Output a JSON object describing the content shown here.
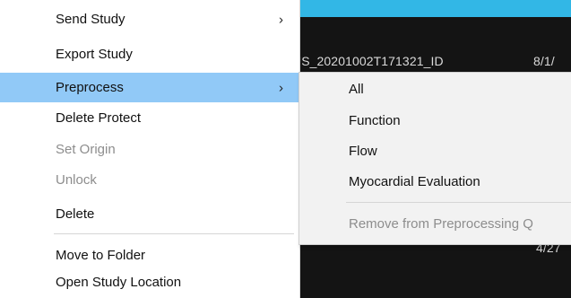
{
  "background": {
    "rows": [
      {
        "name": "US_20201002T171321_ID",
        "date": "8/1/"
      },
      {
        "date": "4/27"
      }
    ],
    "colors": {
      "panel": "#141414",
      "accent": "#32b7e6"
    }
  },
  "context_menu": {
    "items": [
      {
        "label": "Send Study",
        "has_submenu": true,
        "enabled": true
      },
      {
        "label": "Export Study",
        "enabled": true
      },
      {
        "label": "Preprocess",
        "has_submenu": true,
        "enabled": true,
        "highlighted": true
      },
      {
        "label": "Delete Protect",
        "enabled": true
      },
      {
        "label": "Set Origin",
        "enabled": false
      },
      {
        "label": "Unlock",
        "enabled": false
      },
      {
        "label": "Delete",
        "enabled": true
      },
      {
        "label": "Move to Folder",
        "enabled": true
      },
      {
        "label": "Open Study Location",
        "enabled": true
      }
    ],
    "chevron": "›",
    "highlight_color": "#91c9f7"
  },
  "submenu": {
    "parent": "Preprocess",
    "items": [
      {
        "label": "All",
        "enabled": true
      },
      {
        "label": "Function",
        "enabled": true
      },
      {
        "label": "Flow",
        "enabled": true
      },
      {
        "label": "Myocardial Evaluation",
        "enabled": true
      },
      {
        "label": "Remove from Preprocessing Q",
        "enabled": false
      }
    ]
  }
}
